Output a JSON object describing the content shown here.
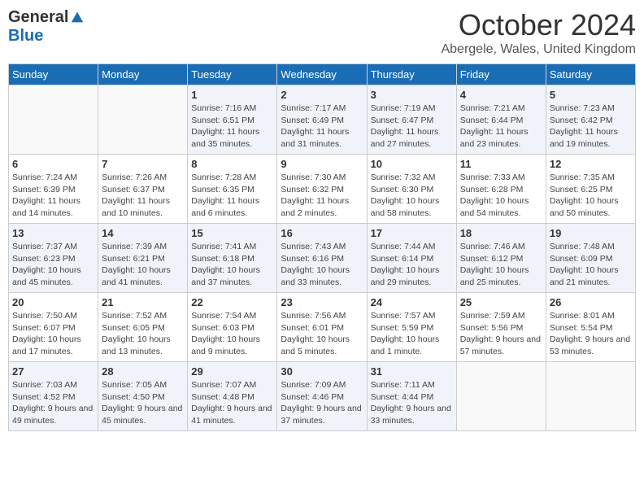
{
  "header": {
    "logo_general": "General",
    "logo_blue": "Blue",
    "month_title": "October 2024",
    "subtitle": "Abergele, Wales, United Kingdom"
  },
  "days_of_week": [
    "Sunday",
    "Monday",
    "Tuesday",
    "Wednesday",
    "Thursday",
    "Friday",
    "Saturday"
  ],
  "weeks": [
    [
      {
        "day": "",
        "info": ""
      },
      {
        "day": "",
        "info": ""
      },
      {
        "day": "1",
        "info": "Sunrise: 7:16 AM\nSunset: 6:51 PM\nDaylight: 11 hours and 35 minutes."
      },
      {
        "day": "2",
        "info": "Sunrise: 7:17 AM\nSunset: 6:49 PM\nDaylight: 11 hours and 31 minutes."
      },
      {
        "day": "3",
        "info": "Sunrise: 7:19 AM\nSunset: 6:47 PM\nDaylight: 11 hours and 27 minutes."
      },
      {
        "day": "4",
        "info": "Sunrise: 7:21 AM\nSunset: 6:44 PM\nDaylight: 11 hours and 23 minutes."
      },
      {
        "day": "5",
        "info": "Sunrise: 7:23 AM\nSunset: 6:42 PM\nDaylight: 11 hours and 19 minutes."
      }
    ],
    [
      {
        "day": "6",
        "info": "Sunrise: 7:24 AM\nSunset: 6:39 PM\nDaylight: 11 hours and 14 minutes."
      },
      {
        "day": "7",
        "info": "Sunrise: 7:26 AM\nSunset: 6:37 PM\nDaylight: 11 hours and 10 minutes."
      },
      {
        "day": "8",
        "info": "Sunrise: 7:28 AM\nSunset: 6:35 PM\nDaylight: 11 hours and 6 minutes."
      },
      {
        "day": "9",
        "info": "Sunrise: 7:30 AM\nSunset: 6:32 PM\nDaylight: 11 hours and 2 minutes."
      },
      {
        "day": "10",
        "info": "Sunrise: 7:32 AM\nSunset: 6:30 PM\nDaylight: 10 hours and 58 minutes."
      },
      {
        "day": "11",
        "info": "Sunrise: 7:33 AM\nSunset: 6:28 PM\nDaylight: 10 hours and 54 minutes."
      },
      {
        "day": "12",
        "info": "Sunrise: 7:35 AM\nSunset: 6:25 PM\nDaylight: 10 hours and 50 minutes."
      }
    ],
    [
      {
        "day": "13",
        "info": "Sunrise: 7:37 AM\nSunset: 6:23 PM\nDaylight: 10 hours and 45 minutes."
      },
      {
        "day": "14",
        "info": "Sunrise: 7:39 AM\nSunset: 6:21 PM\nDaylight: 10 hours and 41 minutes."
      },
      {
        "day": "15",
        "info": "Sunrise: 7:41 AM\nSunset: 6:18 PM\nDaylight: 10 hours and 37 minutes."
      },
      {
        "day": "16",
        "info": "Sunrise: 7:43 AM\nSunset: 6:16 PM\nDaylight: 10 hours and 33 minutes."
      },
      {
        "day": "17",
        "info": "Sunrise: 7:44 AM\nSunset: 6:14 PM\nDaylight: 10 hours and 29 minutes."
      },
      {
        "day": "18",
        "info": "Sunrise: 7:46 AM\nSunset: 6:12 PM\nDaylight: 10 hours and 25 minutes."
      },
      {
        "day": "19",
        "info": "Sunrise: 7:48 AM\nSunset: 6:09 PM\nDaylight: 10 hours and 21 minutes."
      }
    ],
    [
      {
        "day": "20",
        "info": "Sunrise: 7:50 AM\nSunset: 6:07 PM\nDaylight: 10 hours and 17 minutes."
      },
      {
        "day": "21",
        "info": "Sunrise: 7:52 AM\nSunset: 6:05 PM\nDaylight: 10 hours and 13 minutes."
      },
      {
        "day": "22",
        "info": "Sunrise: 7:54 AM\nSunset: 6:03 PM\nDaylight: 10 hours and 9 minutes."
      },
      {
        "day": "23",
        "info": "Sunrise: 7:56 AM\nSunset: 6:01 PM\nDaylight: 10 hours and 5 minutes."
      },
      {
        "day": "24",
        "info": "Sunrise: 7:57 AM\nSunset: 5:59 PM\nDaylight: 10 hours and 1 minute."
      },
      {
        "day": "25",
        "info": "Sunrise: 7:59 AM\nSunset: 5:56 PM\nDaylight: 9 hours and 57 minutes."
      },
      {
        "day": "26",
        "info": "Sunrise: 8:01 AM\nSunset: 5:54 PM\nDaylight: 9 hours and 53 minutes."
      }
    ],
    [
      {
        "day": "27",
        "info": "Sunrise: 7:03 AM\nSunset: 4:52 PM\nDaylight: 9 hours and 49 minutes."
      },
      {
        "day": "28",
        "info": "Sunrise: 7:05 AM\nSunset: 4:50 PM\nDaylight: 9 hours and 45 minutes."
      },
      {
        "day": "29",
        "info": "Sunrise: 7:07 AM\nSunset: 4:48 PM\nDaylight: 9 hours and 41 minutes."
      },
      {
        "day": "30",
        "info": "Sunrise: 7:09 AM\nSunset: 4:46 PM\nDaylight: 9 hours and 37 minutes."
      },
      {
        "day": "31",
        "info": "Sunrise: 7:11 AM\nSunset: 4:44 PM\nDaylight: 9 hours and 33 minutes."
      },
      {
        "day": "",
        "info": ""
      },
      {
        "day": "",
        "info": ""
      }
    ]
  ]
}
